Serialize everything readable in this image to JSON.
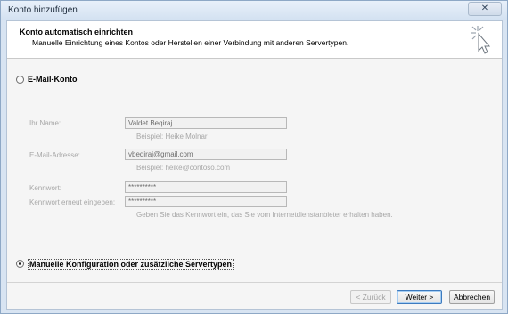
{
  "window": {
    "title": "Konto hinzufügen",
    "close_glyph": "✕"
  },
  "header": {
    "title": "Konto automatisch einrichten",
    "subtitle": "Manuelle Einrichtung eines Kontos oder Herstellen einer Verbindung mit anderen Servertypen.",
    "icon": "wizard-cursor-icon"
  },
  "options": {
    "email_account": {
      "label": "E-Mail-Konto",
      "selected": false
    },
    "manual_config": {
      "label": "Manuelle Konfiguration oder zusätzliche Servertypen",
      "selected": true
    }
  },
  "form": {
    "name": {
      "label": "Ihr Name:",
      "value": "Valdet Beqiraj",
      "hint": "Beispiel: Heike Molnar"
    },
    "email": {
      "label": "E-Mail-Adresse:",
      "value": "vbeqiraj@gmail.com",
      "hint": "Beispiel: heike@contoso.com"
    },
    "password": {
      "label": "Kennwort:",
      "value": "**********"
    },
    "password_repeat": {
      "label": "Kennwort erneut eingeben:",
      "value": "**********",
      "hint": "Geben Sie das Kennwort ein, das Sie vom Internetdienstanbieter erhalten haben."
    }
  },
  "buttons": {
    "back": "< Zurück",
    "next": "Weiter >",
    "cancel": "Abbrechen"
  }
}
